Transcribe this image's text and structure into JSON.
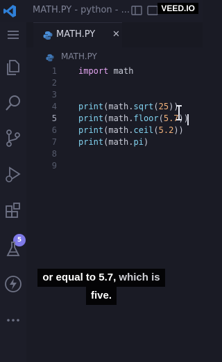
{
  "window": {
    "title": "MATH.PY - python - ..."
  },
  "watermark": "VEED.IO",
  "tab": {
    "label": "MATH.PY",
    "close": "✕"
  },
  "breadcrumb": {
    "file": "MATH.PY"
  },
  "activitybar": {
    "extensions_badge": "5",
    "items": [
      "menu-icon",
      "explorer-icon",
      "search-icon",
      "source-control-icon",
      "run-debug-icon",
      "extensions-icon",
      "testing-icon",
      "lightning-icon",
      "more-icon"
    ]
  },
  "code": {
    "line_numbers": [
      "1",
      "2",
      "3",
      "4",
      "5",
      "6",
      "7",
      "8",
      "9"
    ],
    "active_line": "5",
    "l1": {
      "kw": "import",
      "rest": " math"
    },
    "l4": {
      "fn": "print",
      "p1": "(",
      "mod": "math",
      "dot": ".",
      "attr": "sqrt",
      "p2": "(",
      "arg": "25",
      "p3": "))"
    },
    "l5": {
      "fn": "print",
      "p1": "(",
      "mod": "math",
      "dot": ".",
      "attr": "floor",
      "p2": "(",
      "arg": "5.7",
      "p3": "))"
    },
    "l6": {
      "fn": "print",
      "p1": "(",
      "mod": "math",
      "dot": ".",
      "attr": "ceil",
      "p2": "(",
      "arg": "5.2",
      "p3": "))"
    },
    "l7": {
      "fn": "print",
      "p1": "(",
      "mod": "math",
      "dot": ".",
      "attr": "pi",
      "p3": ")"
    }
  },
  "caption": {
    "line1_bold": "or equal to 5.7,",
    "line1_rest": " which is",
    "line2": "five."
  },
  "colors": {
    "accent": "#7f7ae8",
    "keyword": "#e3a4f0",
    "function": "#82d3f0",
    "number": "#f3b27a",
    "vscode_blue": "#2f80d8",
    "python_blue": "#4a8fd9"
  }
}
